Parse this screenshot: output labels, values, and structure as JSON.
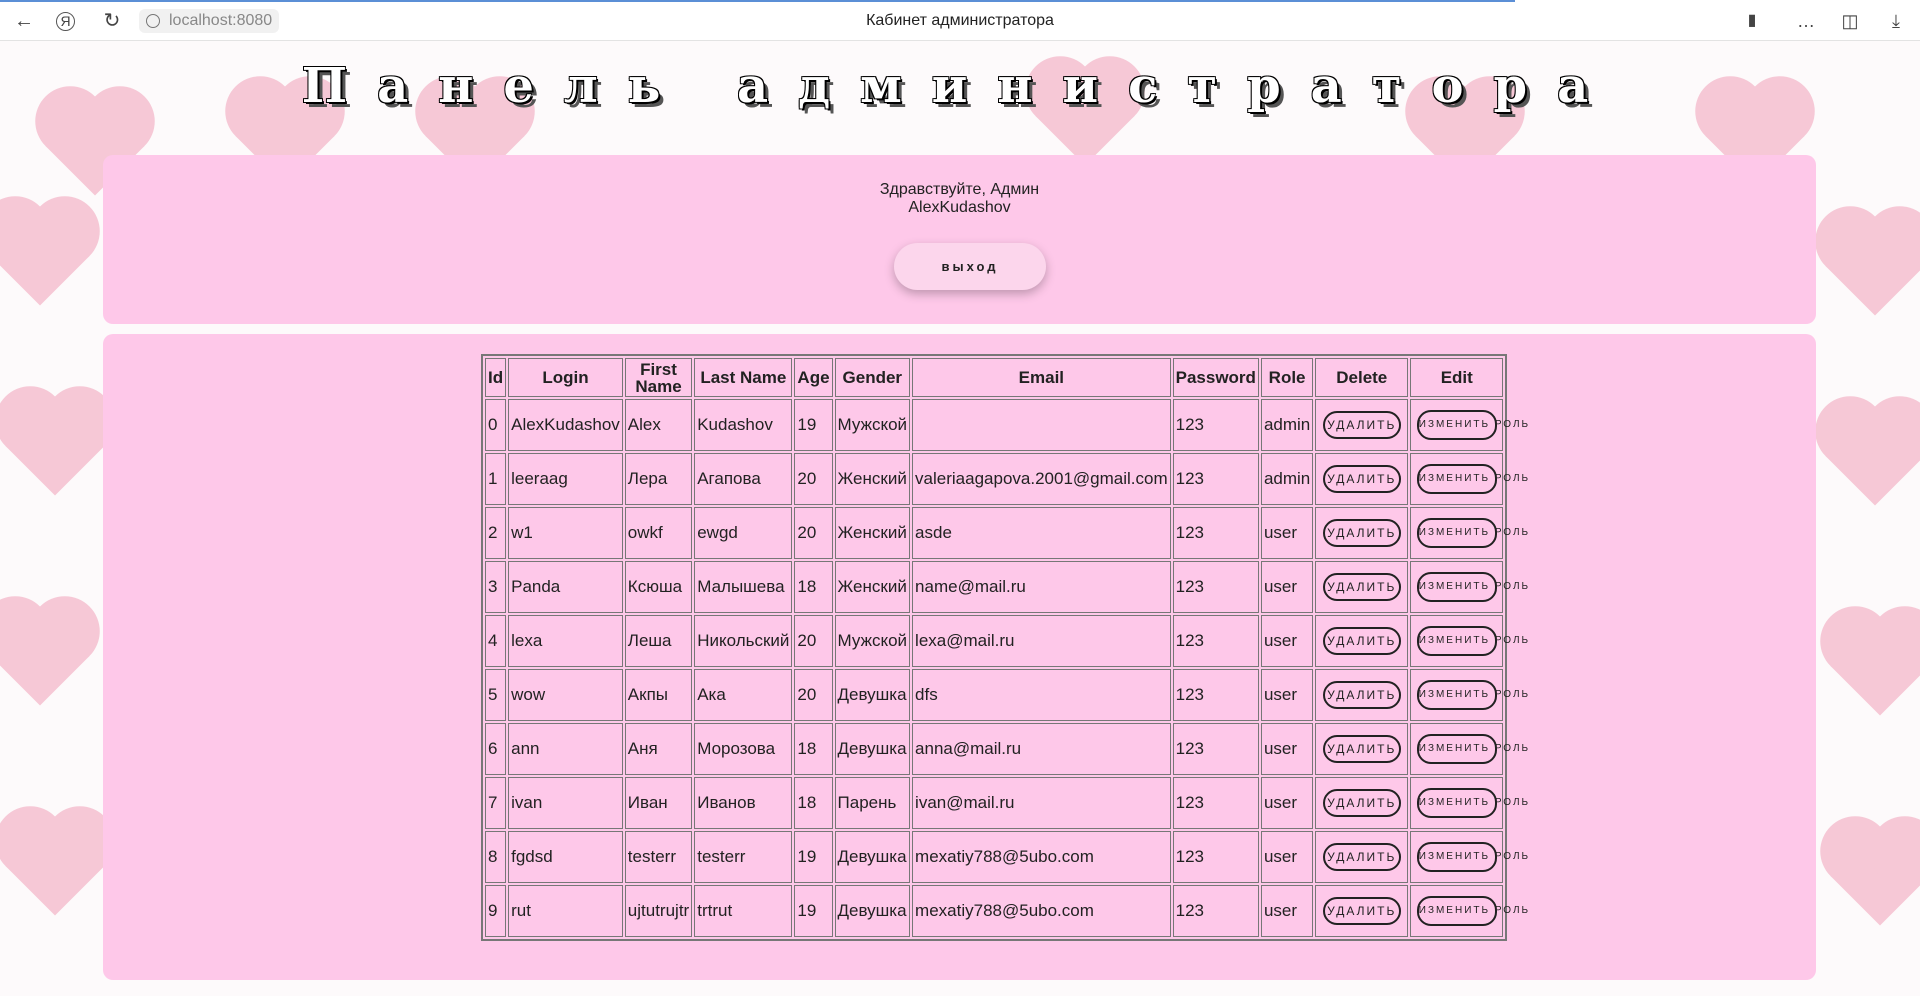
{
  "browser": {
    "url": "localhost:8080",
    "tab_title": "Кабинет администратора"
  },
  "page": {
    "title": "Панель администратора",
    "greeting_line1": "Здравствуйте, Админ",
    "greeting_line2": "AlexKudashov",
    "logout_label": "выход"
  },
  "table": {
    "headers": [
      "Id",
      "Login",
      "First Name",
      "Last Name",
      "Age",
      "Gender",
      "Email",
      "Password",
      "Role",
      "Delete",
      "Edit"
    ],
    "delete_label": "УДАЛИТЬ",
    "edit_label": "ИЗМЕНИТЬ РОЛЬ",
    "rows": [
      [
        "0",
        "AlexKudashov",
        "Alex",
        "Kudashov",
        "19",
        "Мужской",
        "",
        "123",
        "admin"
      ],
      [
        "1",
        "leeraag",
        "Лера",
        "Агапова",
        "20",
        "Женский",
        "valeriaagapova.2001@gmail.com",
        "123",
        "admin"
      ],
      [
        "2",
        "w1",
        "owkf",
        "ewgd",
        "20",
        "Женский",
        "asde",
        "123",
        "user"
      ],
      [
        "3",
        "Panda",
        "Ксюша",
        "Малышева",
        "18",
        "Женский",
        "name@mail.ru",
        "123",
        "user"
      ],
      [
        "4",
        "lexa",
        "Леша",
        "Никольский",
        "20",
        "Мужской",
        "lexa@mail.ru",
        "123",
        "user"
      ],
      [
        "5",
        "wow",
        "Акпы",
        "Ака",
        "20",
        "Девушка",
        "dfs",
        "123",
        "user"
      ],
      [
        "6",
        "ann",
        "Аня",
        "Морозова",
        "18",
        "Девушка",
        "anna@mail.ru",
        "123",
        "user"
      ],
      [
        "7",
        "ivan",
        "Иван",
        "Иванов",
        "18",
        "Парень",
        "ivan@mail.ru",
        "123",
        "user"
      ],
      [
        "8",
        "fgdsd",
        "testerr",
        "testerr",
        "19",
        "Девушка",
        "mexatiy788@5ubo.com",
        "123",
        "user"
      ],
      [
        "9",
        "rut",
        "ujtutrujtr",
        "trtrut",
        "19",
        "Девушка",
        "mexatiy788@5ubo.com",
        "123",
        "user"
      ]
    ]
  }
}
